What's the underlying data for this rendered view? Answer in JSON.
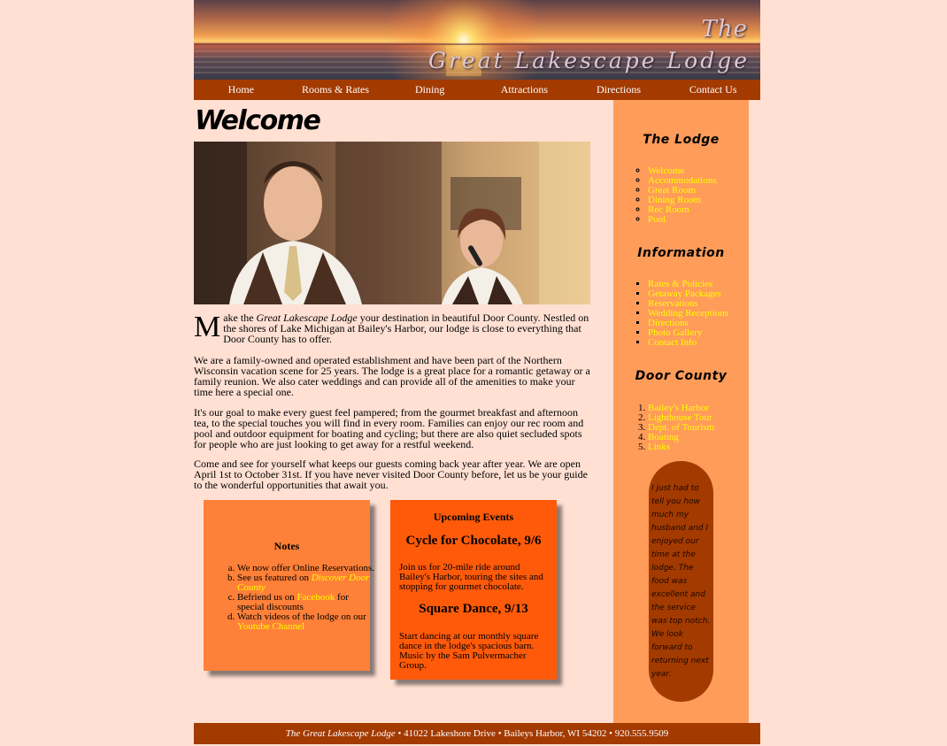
{
  "banner": {
    "title_line1": "The",
    "title_line2": "Great Lakescape Lodge"
  },
  "nav": {
    "items": [
      "Home",
      "Rooms & Rates",
      "Dining",
      "Attractions",
      "Directions",
      "Contact Us"
    ]
  },
  "main": {
    "heading": "Welcome",
    "paragraph1": {
      "dropcap": "M",
      "before": "ake the ",
      "italic": "Great Lakescape Lodge",
      "after": " your destination in beautiful Door County. Nestled on the shores of Lake Michigan at Bailey's Harbor, our lodge is close to everything that Door County has to offer."
    },
    "paragraph2": "We are a family-owned and operated establishment and have been part of the Northern Wisconsin vacation scene for 25 years. The lodge is a great place for a romantic getaway or a family reunion. We also cater weddings and can provide all of the amenities to make your time here a special one.",
    "paragraph3": "It's our goal to make every guest feel pampered; from the gourmet breakfast and afternoon tea, to the special touches you will find in every room. Families can enjoy our rec room and pool and outdoor equipment for boating and cycling; but there are also quiet secluded spots for people who are just looking to get away for a restful weekend.",
    "paragraph4": "Come and see for yourself what keeps our guests coming back year after year. We are open April 1st to October 31st. If you have never visited Door County before, let us be your guide to the wonderful opportunities that await you."
  },
  "notes": {
    "title": "Notes",
    "item_a": "We now offer Online Reservations.",
    "item_b_text": "See us featured on ",
    "item_b_link": "Discover Door County",
    "item_c_text": "Befriend us on ",
    "item_c_link": "Facebook",
    "item_c_after": " for special discounts",
    "item_d_text": "Watch videos of the lodge on our ",
    "item_d_link": "Youtube Channel"
  },
  "events": {
    "title": "Upcoming Events",
    "event1_heading": "Cycle for Chocolate, 9/6",
    "event1_text": "Join us for 20-mile ride around Bailey's Harbor, touring the sites and stopping for gourmet chocolate.",
    "event2_heading": "Square Dance, 9/13",
    "event2_text": "Start dancing at our monthly square dance in the lodge's spacious barn. Music by the Sam Pulvermacher Group."
  },
  "sidebar": {
    "lodge_heading": "The Lodge",
    "lodge_links": [
      "Welcome",
      "Accommodations",
      "Great Room",
      "Dining Room",
      "Rec Room",
      "Pool"
    ],
    "info_heading": "Information",
    "info_links": [
      "Rates & Policies",
      "Getaway Packages",
      "Reservations",
      "Wedding Receptions",
      "Directions",
      "Photo Gallery",
      "Contact Info"
    ],
    "county_heading": "Door County",
    "county_links": [
      "Bailey's Harbor",
      "Lighthouse Tour",
      "Dept. of Tourism",
      "Boating",
      "Links"
    ],
    "testimonial": "I just had to tell you how much my husband and I enjoyed our time at the lodge. The food was excellent and the service was top notch. We look forward to returning next year."
  },
  "footer": {
    "name": "The Great Lakescape Lodge",
    "address": " • 41022 Lakeshore Drive • Baileys Harbor, WI 54202 • 920.555.9509"
  },
  "colors": {
    "page_bg": "#ffe0d3",
    "nav_bg": "#a33a00",
    "sidebar_bg": "#ff9c5a",
    "notes_bg": "#ff8038",
    "events_bg": "#ff5a0a",
    "link": "#ffff00"
  }
}
